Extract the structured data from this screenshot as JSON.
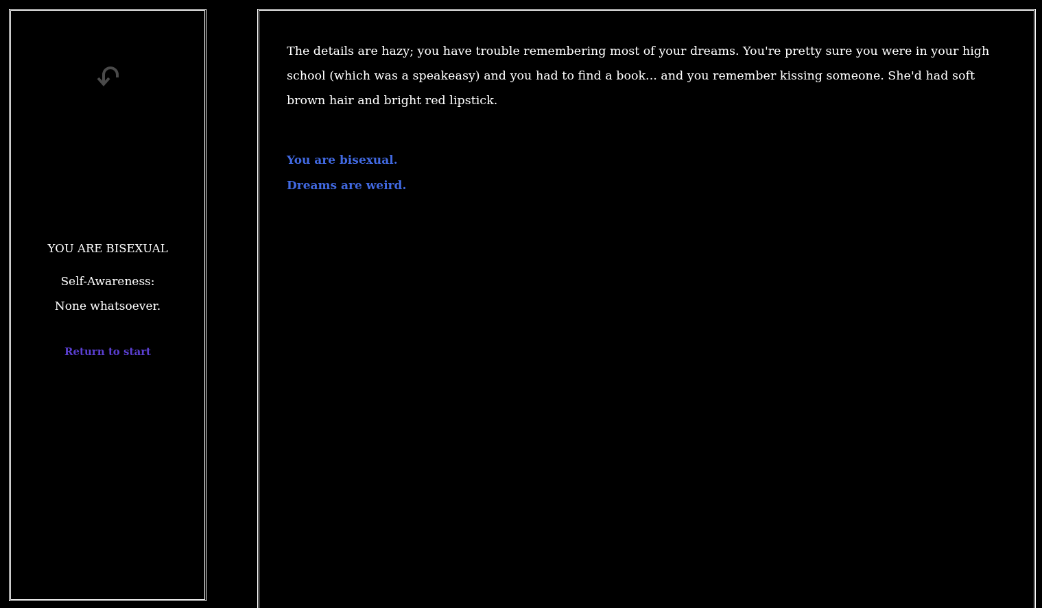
{
  "sidebar": {
    "back_button": {
      "disabled": true
    },
    "title": "YOU ARE BISEXUAL",
    "stats": [
      {
        "label": "Self-Awareness:",
        "value": "None whatsoever."
      }
    ],
    "restart_link": "Return to start"
  },
  "passage": {
    "text": "The details are hazy; you have trouble remembering most of your dreams. You're pretty sure you were in your high school (which was a speakeasy) and you had to find a book... and you remember kissing someone. She'd had soft brown hair and bright red lipstick.",
    "links": [
      "You are bisexual.",
      "Dreams are weird."
    ]
  }
}
